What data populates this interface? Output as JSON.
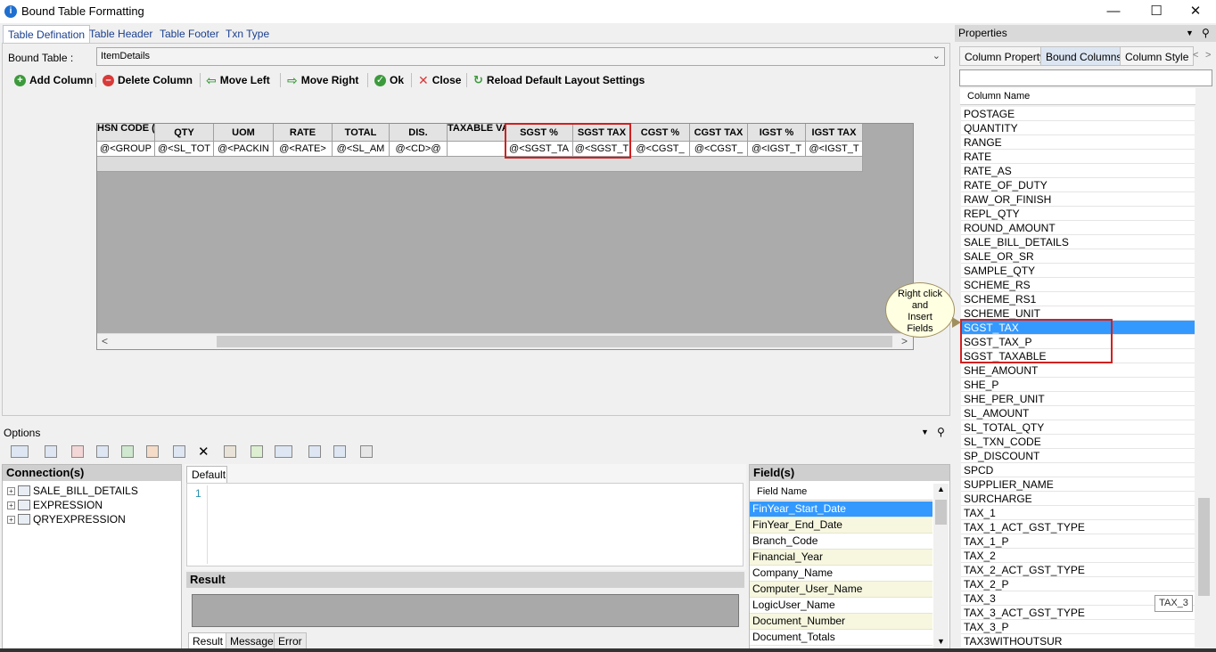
{
  "window": {
    "title": "Bound Table Formatting",
    "icon": "app-icon"
  },
  "tabs": [
    "Table Defination",
    "Table Header",
    "Table Footer",
    "Txn Type"
  ],
  "bound_table": {
    "label": "Bound Table :",
    "value": "ItemDetails"
  },
  "toolbar": {
    "add_column": "Add Column",
    "delete_column": "Delete Column",
    "move_left": "Move Left",
    "move_right": "Move Right",
    "ok": "Ok",
    "close": "Close",
    "reload": "Reload Default Layout Settings"
  },
  "grid": {
    "headers": [
      "HSN CODE (GS",
      "QTY",
      "UOM",
      "RATE",
      "TOTAL",
      "DIS.",
      "TAXABLE VAL",
      "SGST %",
      "SGST TAX",
      "CGST %",
      "CGST TAX",
      "IGST %",
      "IGST TAX"
    ],
    "values": [
      "@<GROUP",
      "@<SL_TOT",
      "@<PACKIN",
      "@<RATE>",
      "@<SL_AM",
      "@<CD>@",
      "",
      "@<SGST_TA",
      "@<SGST_T",
      "@<CGST_",
      "@<CGST_",
      "@<IGST_T",
      "@<IGST_T"
    ]
  },
  "options": {
    "label": "Options",
    "connections_title": "Connection(s)",
    "connections": [
      "SALE_BILL_DETAILS",
      "EXPRESSION",
      "QRYEXPRESSION"
    ],
    "editor_tab": "Default",
    "line_number": "1",
    "result_title": "Result",
    "result_tabs": [
      "Result",
      "Message",
      "Error"
    ],
    "fields_title": "Field(s)",
    "fields_column": "Field Name",
    "fields": [
      "FinYear_Start_Date",
      "FinYear_End_Date",
      "Branch_Code",
      "Financial_Year",
      "Company_Name",
      "Computer_User_Name",
      "LogicUser_Name",
      "Document_Number",
      "Document_Totals"
    ]
  },
  "properties": {
    "title": "Properties",
    "tabs": [
      "Column Property",
      "Bound Columns",
      "Column Style"
    ],
    "column_header": "Column Name",
    "columns": [
      "POSTAGE",
      "QUANTITY",
      "RANGE",
      "RATE",
      "RATE_AS",
      "RATE_OF_DUTY",
      "RAW_OR_FINISH",
      "REPL_QTY",
      "ROUND_AMOUNT",
      "SALE_BILL_DETAILS",
      "SALE_OR_SR",
      "SAMPLE_QTY",
      "SCHEME_RS",
      "SCHEME_RS1",
      "SCHEME_UNIT",
      "SGST_TAX",
      "SGST_TAX_P",
      "SGST_TAXABLE",
      "SHE_AMOUNT",
      "SHE_P",
      "SHE_PER_UNIT",
      "SL_AMOUNT",
      "SL_TOTAL_QTY",
      "SL_TXN_CODE",
      "SP_DISCOUNT",
      "SPCD",
      "SUPPLIER_NAME",
      "SURCHARGE",
      "TAX_1",
      "TAX_1_ACT_GST_TYPE",
      "TAX_1_P",
      "TAX_2",
      "TAX_2_ACT_GST_TYPE",
      "TAX_2_P",
      "TAX_3",
      "TAX_3_ACT_GST_TYPE",
      "TAX_3_P",
      "TAX3WITHOUTSUR"
    ],
    "selected": "SGST_TAX",
    "tooltip": "TAX_3"
  },
  "callout": {
    "line1": "Right click",
    "line2": "and",
    "line3": "Insert",
    "line4": "Fields"
  },
  "colors": {
    "accent": "#3399ff",
    "highlight_border": "#d02020",
    "callout_bg": "#ffffe1"
  }
}
